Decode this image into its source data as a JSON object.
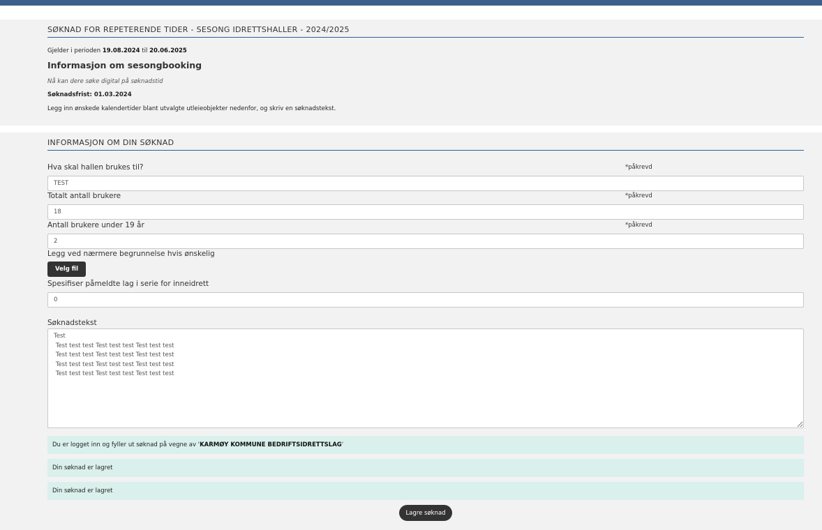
{
  "period": {
    "title": "SØKNAD FOR REPETERENDE TIDER - SESONG IDRETTSHALLER - 2024/2025",
    "prefix": "Gjelder i perioden ",
    "start": "19.08.2024",
    "middle": " til ",
    "end": "20.06.2025"
  },
  "info": {
    "heading": "Informasjon om sesongbooking",
    "digital_note": "Nå kan dere søke digital på søknadstid",
    "deadline": "Søknadsfrist: 01.03.2024",
    "instructions": "Legg inn ønskede kalendertider blant utvalgte utleieobjekter nedenfor, og skriv en søknadstekst."
  },
  "form": {
    "title": "INFORMASJON OM DIN SØKNAD",
    "required_label": "*påkrevd",
    "usage_label": "Hva skal hallen brukes til?",
    "usage_value": "TEST",
    "total_users_label": "Totalt antall brukere",
    "total_users_value": "18",
    "under19_label": "Antall brukere under 19 år",
    "under19_value": "2",
    "attachment_label": "Legg ved nærmere begrunnelse hvis ønskelig",
    "attachment_button": "Velg fil",
    "teams_label": "Spesifiser påmeldte lag i serie for inneidrett",
    "teams_value": "0",
    "text_label": "Søknadstekst",
    "text_value": "Test\n Test test test Test test test Test test test\n Test test test Test test test Test test test\n Test test test Test test test Test test test\n Test test test Test test test Test test test"
  },
  "notices": {
    "logged_in_prefix": "Du er logget inn og fyller ut søknad på vegne av '",
    "organization": "KARMØY KOMMUNE BEDRIFTSIDRETTSLAG",
    "logged_in_suffix": "'",
    "saved_1": "Din søknad er lagret",
    "saved_2": "Din søknad er lagret"
  },
  "actions": {
    "save_button": "Lagre søknad"
  },
  "colors": {
    "top_bar": "#3d5f8c",
    "section_rule": "#2b5f8e",
    "panel_bg": "#f2f2f2",
    "notice_bg": "#daf0ec",
    "button_bg": "#333333"
  }
}
